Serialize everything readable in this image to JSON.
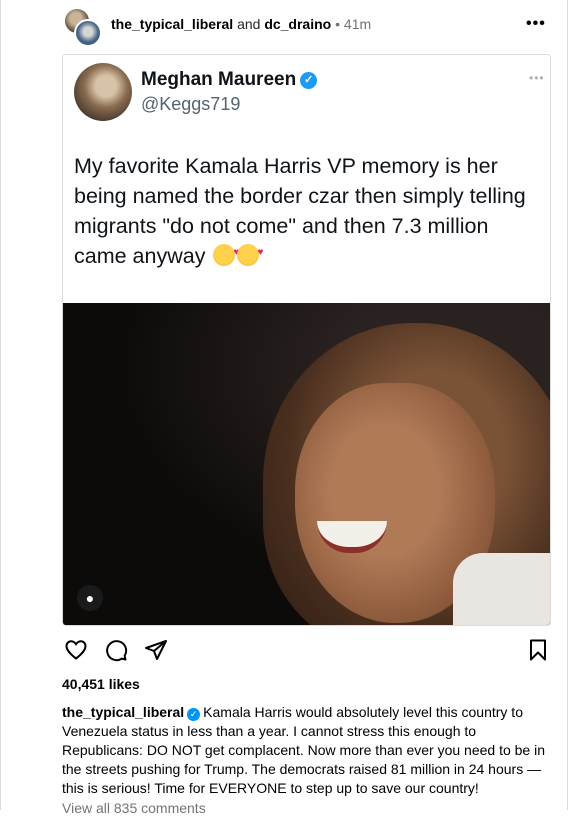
{
  "header": {
    "user1": "the_typical_liberal",
    "joiner": "and",
    "user2": "dc_draino",
    "separator": "•",
    "time": "41m",
    "more": "•••"
  },
  "tweet": {
    "name": "Meghan Maureen",
    "handle": "@Keggs719",
    "more": "•••",
    "text": "My favorite Kamala Harris VP memory is her being named the border czar then simply telling migrants \"do not come\" and then 7.3 million came anyway",
    "emojis": [
      "smiling-face-with-hearts",
      "smiling-face-with-hearts"
    ]
  },
  "actions": {
    "like": "heart-icon",
    "comment": "comment-icon",
    "share": "share-icon",
    "save": "bookmark-icon"
  },
  "likes": "40,451 likes",
  "caption": {
    "username": "the_typical_liberal",
    "text": "Kamala Harris would absolutely level this country to Venezuela status in less than a year. I cannot stress this enough to Republicans: DO NOT get complacent. Now more than ever you need to be in the streets pushing for Trump. The democrats raised 81 million in 24 hours — this is serious! Time for EVERYONE to step up to save our country!"
  },
  "view_comments": "View all 835 comments",
  "colors": {
    "verified_twitter": "#1d9bf0",
    "verified_instagram": "#0095f6",
    "muted_text": "#737373"
  }
}
